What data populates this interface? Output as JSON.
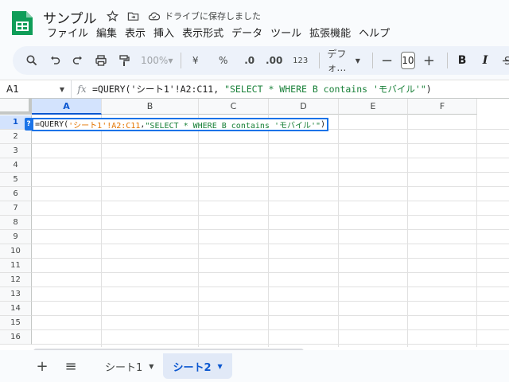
{
  "header": {
    "title": "サンプル",
    "save_status": "ドライブに保存しました",
    "menu": [
      "ファイル",
      "編集",
      "表示",
      "挿入",
      "表示形式",
      "データ",
      "ツール",
      "拡張機能",
      "ヘルプ"
    ]
  },
  "toolbar": {
    "zoom": "100%",
    "currency": "¥",
    "percent": "%",
    "decrease_decimal": ".0",
    "increase_decimal": ".00",
    "number_format": "123",
    "font": "デフォ…",
    "font_size": "10",
    "bold": "B",
    "italic": "I"
  },
  "formula_bar": {
    "cell_ref": "A1",
    "fx": "fx",
    "formula_prefix": "=QUERY('シート1'!A2:C11, ",
    "formula_string": "\"SELECT * WHERE B contains 'モバイル'\"",
    "formula_suffix": ")"
  },
  "grid": {
    "columns": [
      "A",
      "B",
      "C",
      "D",
      "E",
      "F"
    ],
    "rows": [
      "1",
      "2",
      "3",
      "4",
      "5",
      "6",
      "7",
      "8",
      "9",
      "10",
      "11",
      "12",
      "13",
      "14",
      "15",
      "16"
    ],
    "active_cell": {
      "help_badge": "?",
      "prefix": "=QUERY(",
      "range": "'シート1'!A2:C11",
      "comma": ", ",
      "query": "\"SELECT * WHERE B contains 'モバイル'\"",
      "suffix": ")"
    }
  },
  "sheets": {
    "add_label": "+",
    "list_label": "≡",
    "tabs": [
      "シート1",
      "シート2"
    ],
    "active": "シート2"
  },
  "colors": {
    "brand_green": "#0f9d58",
    "accent_blue": "#1a73e8",
    "string_green": "#188038",
    "range_orange": "#e37400"
  }
}
